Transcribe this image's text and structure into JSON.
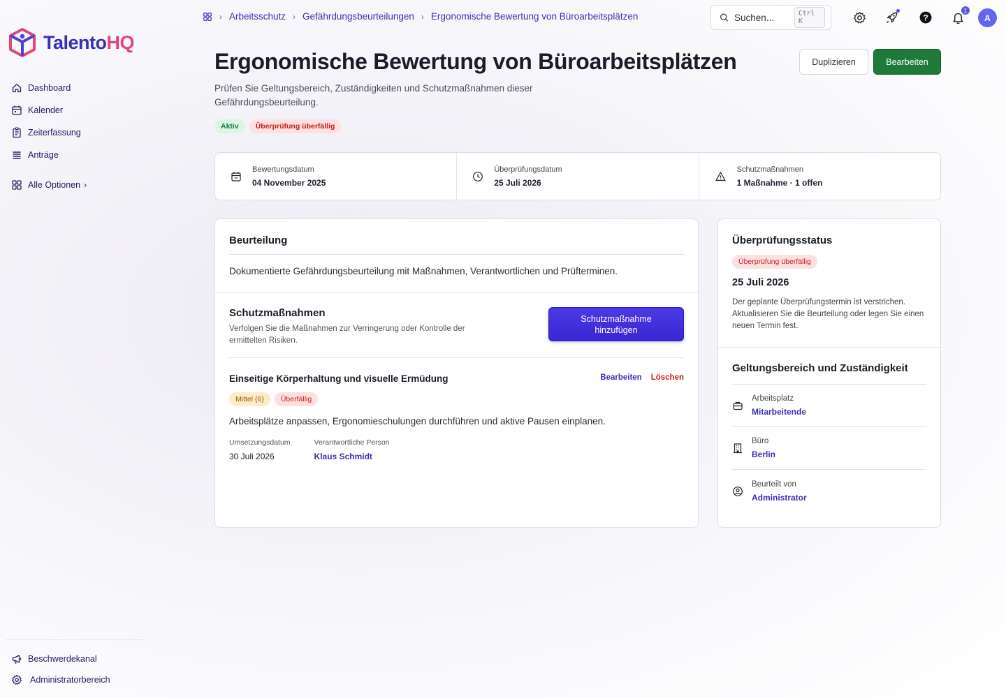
{
  "brand": {
    "name": "Talento",
    "suffix": "HQ",
    "colors": {
      "primary": "#3b2fb8",
      "accent": "#e0457b"
    }
  },
  "sidebar": {
    "items": [
      {
        "label": "Dashboard",
        "icon": "home-icon"
      },
      {
        "label": "Kalender",
        "icon": "calendar-icon"
      },
      {
        "label": "Zeiterfassung",
        "icon": "clipboard-icon"
      },
      {
        "label": "Anträge",
        "icon": "list-icon"
      }
    ],
    "more_label": "Alle Optionen",
    "bottom": [
      {
        "label": "Beschwerdekanal",
        "icon": "megaphone-icon"
      },
      {
        "label": "Administratorbereich",
        "icon": "gear-icon"
      }
    ]
  },
  "breadcrumb": [
    "Arbeitsschutz",
    "Gefährdungsbeurteilungen",
    "Ergonomische Bewertung von Büroarbeitsplätzen"
  ],
  "search": {
    "placeholder": "Suchen...",
    "shortcut": "Ctrl K"
  },
  "topbar": {
    "notification_count": "1",
    "avatar_initial": "A"
  },
  "header": {
    "title": "Ergonomische Bewertung von Büroarbeitsplätzen",
    "subtitle": "Prüfen Sie Geltungsbereich, Zuständigkeiten und Schutzmaßnahmen dieser Gefährdungsbeurteilung.",
    "tags": [
      "Aktiv",
      "Überprüfung überfällig"
    ],
    "duplicate_label": "Duplizieren",
    "edit_label": "Bearbeiten"
  },
  "stats": [
    {
      "label": "Bewertungsdatum",
      "value": "04 November 2025",
      "icon": "calendar-icon"
    },
    {
      "label": "Überprüfungsdatum",
      "value": "25 Juli 2026",
      "icon": "clock-icon"
    },
    {
      "label": "Schutzmaßnahmen",
      "value": "1 Maßnahme · 1 offen",
      "icon": "warning-icon"
    }
  ],
  "assessment": {
    "title": "Beurteilung",
    "text": "Dokumentierte Gefährdungsbeurteilung mit Maßnahmen, Verantwortlichen und Prüfterminen."
  },
  "measures": {
    "title": "Schutzmaßnahmen",
    "description": "Verfolgen Sie die Maßnahmen zur Verringerung oder Kontrolle der ermittelten Risiken.",
    "add_label": "Schutzmaßnahme hinzufügen",
    "items": [
      {
        "title": "Einseitige Körperhaltung und visuelle Ermüdung",
        "edit_label": "Bearbeiten",
        "delete_label": "Löschen",
        "risk": "Mittel (6)",
        "status": "Überfällig",
        "text": "Arbeitsplätze anpassen, Ergonomieschulungen durchführen und aktive Pausen einplanen.",
        "date_label": "Umsetzungsdatum",
        "date": "30 Juli 2026",
        "owner_label": "Verantwortliche Person",
        "owner": "Klaus Schmidt"
      }
    ]
  },
  "review": {
    "title": "Überprüfungsstatus",
    "badge": "Überprüfung überfällig",
    "date": "25 Juli 2026",
    "text": "Der geplante Überprüfungstermin ist verstrichen. Aktualisieren Sie die Beurteilung oder legen Sie einen neuen Termin fest."
  },
  "scope": {
    "title": "Geltungsbereich und Zuständigkeit",
    "rows": [
      {
        "label": "Arbeitsplatz",
        "value": "Mitarbeitende",
        "icon": "briefcase-icon"
      },
      {
        "label": "Büro",
        "value": "Berlin",
        "icon": "building-icon"
      },
      {
        "label": "Beurteilt von",
        "value": "Administrator",
        "icon": "user-circle-icon"
      }
    ]
  }
}
